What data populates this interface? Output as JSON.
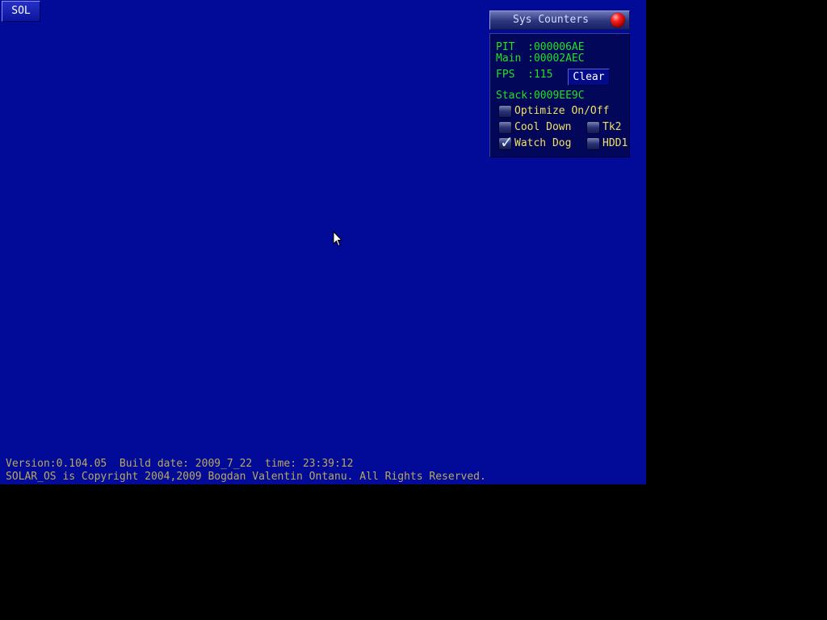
{
  "taskbar": {
    "start_label": "SOL"
  },
  "sys_counters": {
    "title": "Sys Counters",
    "pit": "PIT  :000006AE",
    "main": "Main :00002AEC",
    "fps": "FPS  :115",
    "clear_label": "Clear",
    "stack": "Stack:0009EE9C",
    "options": {
      "optimize": {
        "label": "Optimize On/Off",
        "checked": false
      },
      "cool_down": {
        "label": "Cool Down",
        "checked": false
      },
      "tk2": {
        "label": "Tk2",
        "checked": false
      },
      "watch_dog": {
        "label": "Watch Dog",
        "checked": true
      },
      "hdd1": {
        "label": "HDD1",
        "checked": false
      }
    }
  },
  "footer": {
    "version_line": "Version:0.104.05  Build date: 2009_7_22  time: 23:39:12",
    "copyright_line": "SOLAR_OS is Copyright 2004,2009 Bogdan Valentin Ontanu. All Rights Reserved."
  },
  "colors": {
    "desktop": "#020a98",
    "counter_text": "#22e022",
    "option_text": "#f0e060",
    "footer_text": "#b8a860"
  }
}
